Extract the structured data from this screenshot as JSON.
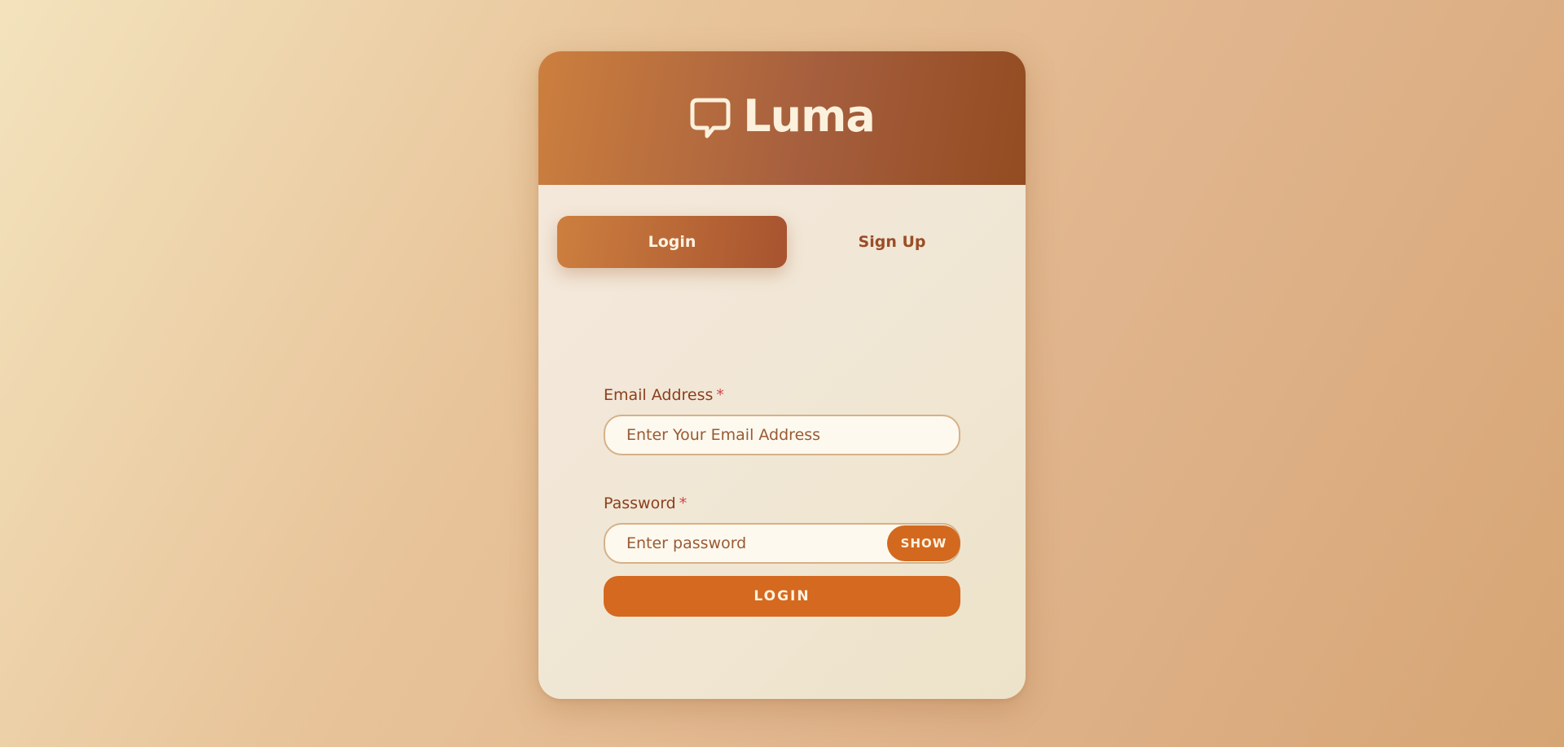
{
  "brand": {
    "name": "Luma",
    "icon": "chat-bubble-icon"
  },
  "tabs": [
    {
      "label": "Login",
      "active": true
    },
    {
      "label": "Sign Up",
      "active": false
    }
  ],
  "form": {
    "email": {
      "label": "Email Address",
      "required_mark": "*",
      "placeholder": "Enter Your Email Address",
      "value": ""
    },
    "password": {
      "label": "Password",
      "required_mark": "*",
      "placeholder": "Enter password",
      "value": "",
      "toggle_label": "SHOW"
    },
    "submit_label": "LOGIN"
  },
  "colors": {
    "accent": "#d4691f",
    "header_start": "#cc7f3e",
    "header_end": "#934b21",
    "label_text": "#8a3f1d",
    "required": "#d0454a"
  }
}
